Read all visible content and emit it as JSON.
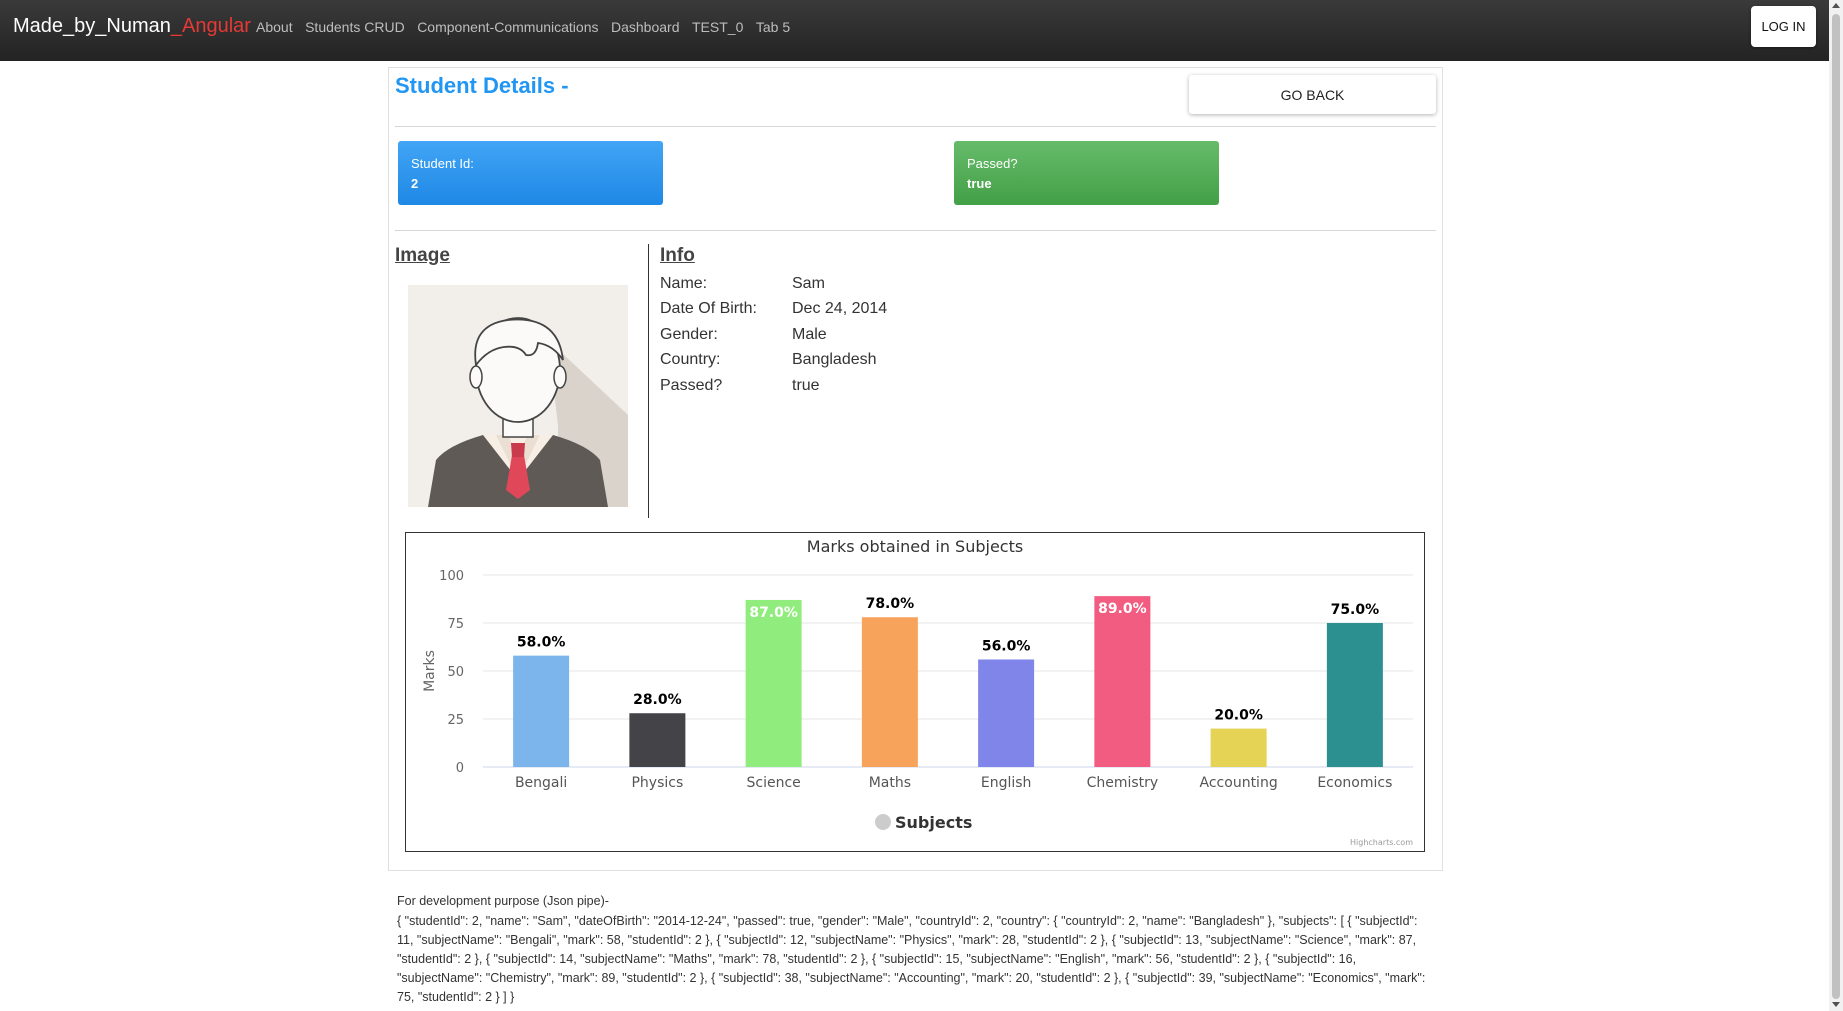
{
  "nav": {
    "brand_main": "Made_by_Numan",
    "brand_accent": "_Angular",
    "links": [
      "About",
      "Students CRUD",
      "Component-Communications",
      "Dashboard",
      "TEST_0",
      "Tab 5"
    ],
    "login_label": "LOG IN"
  },
  "page": {
    "title": "Student Details -",
    "back_label": "GO BACK"
  },
  "stats": {
    "id_label": "Student Id:",
    "id_value": "2",
    "passed_label": "Passed?",
    "passed_value": "true"
  },
  "sections": {
    "image_heading": "Image",
    "info_heading": "Info"
  },
  "info": [
    {
      "label": "Name:",
      "value": "Sam"
    },
    {
      "label": "Date Of Birth:",
      "value": "Dec 24, 2014"
    },
    {
      "label": "Gender:",
      "value": "Male"
    },
    {
      "label": "Country:",
      "value": "Bangladesh"
    },
    {
      "label": "Passed?",
      "value": "true"
    }
  ],
  "chart_data": {
    "type": "bar",
    "title": "Marks obtained in Subjects",
    "xlabel": "",
    "ylabel": "Marks",
    "ylim": [
      0,
      100
    ],
    "yticks": [
      0,
      25,
      50,
      75,
      100
    ],
    "grid": true,
    "legend": {
      "label": "Subjects",
      "placement": "bottom-center"
    },
    "credit": "Highcharts.com",
    "categories": [
      "Bengali",
      "Physics",
      "Science",
      "Maths",
      "English",
      "Chemistry",
      "Accounting",
      "Economics"
    ],
    "values": [
      58,
      28,
      87,
      78,
      56,
      89,
      20,
      75
    ],
    "data_labels": [
      "58.0%",
      "28.0%",
      "87.0%",
      "78.0%",
      "56.0%",
      "89.0%",
      "20.0%",
      "75.0%"
    ],
    "colors": [
      "#7cb5ec",
      "#434348",
      "#90ed7d",
      "#f7a35c",
      "#8085e9",
      "#f15c80",
      "#e4d354",
      "#2b908f"
    ]
  },
  "dev": {
    "title": "For development purpose (Json pipe)-",
    "json": "{ \"studentId\": 2, \"name\": \"Sam\", \"dateOfBirth\": \"2014-12-24\", \"passed\": true, \"gender\": \"Male\", \"countryId\": 2, \"country\": { \"countryId\": 2, \"name\": \"Bangladesh\" }, \"subjects\": [ { \"subjectId\": 11, \"subjectName\": \"Bengali\", \"mark\": 58, \"studentId\": 2 }, { \"subjectId\": 12, \"subjectName\": \"Physics\", \"mark\": 28, \"studentId\": 2 }, { \"subjectId\": 13, \"subjectName\": \"Science\", \"mark\": 87, \"studentId\": 2 }, { \"subjectId\": 14, \"subjectName\": \"Maths\", \"mark\": 78, \"studentId\": 2 }, { \"subjectId\": 15, \"subjectName\": \"English\", \"mark\": 56, \"studentId\": 2 }, { \"subjectId\": 16, \"subjectName\": \"Chemistry\", \"mark\": 89, \"studentId\": 2 }, { \"subjectId\": 38, \"subjectName\": \"Accounting\", \"mark\": 20, \"studentId\": 2 }, { \"subjectId\": 39, \"subjectName\": \"Economics\", \"mark\": 75, \"studentId\": 2 } ] }"
  },
  "icons": {
    "avatar": "student-avatar-icon"
  }
}
